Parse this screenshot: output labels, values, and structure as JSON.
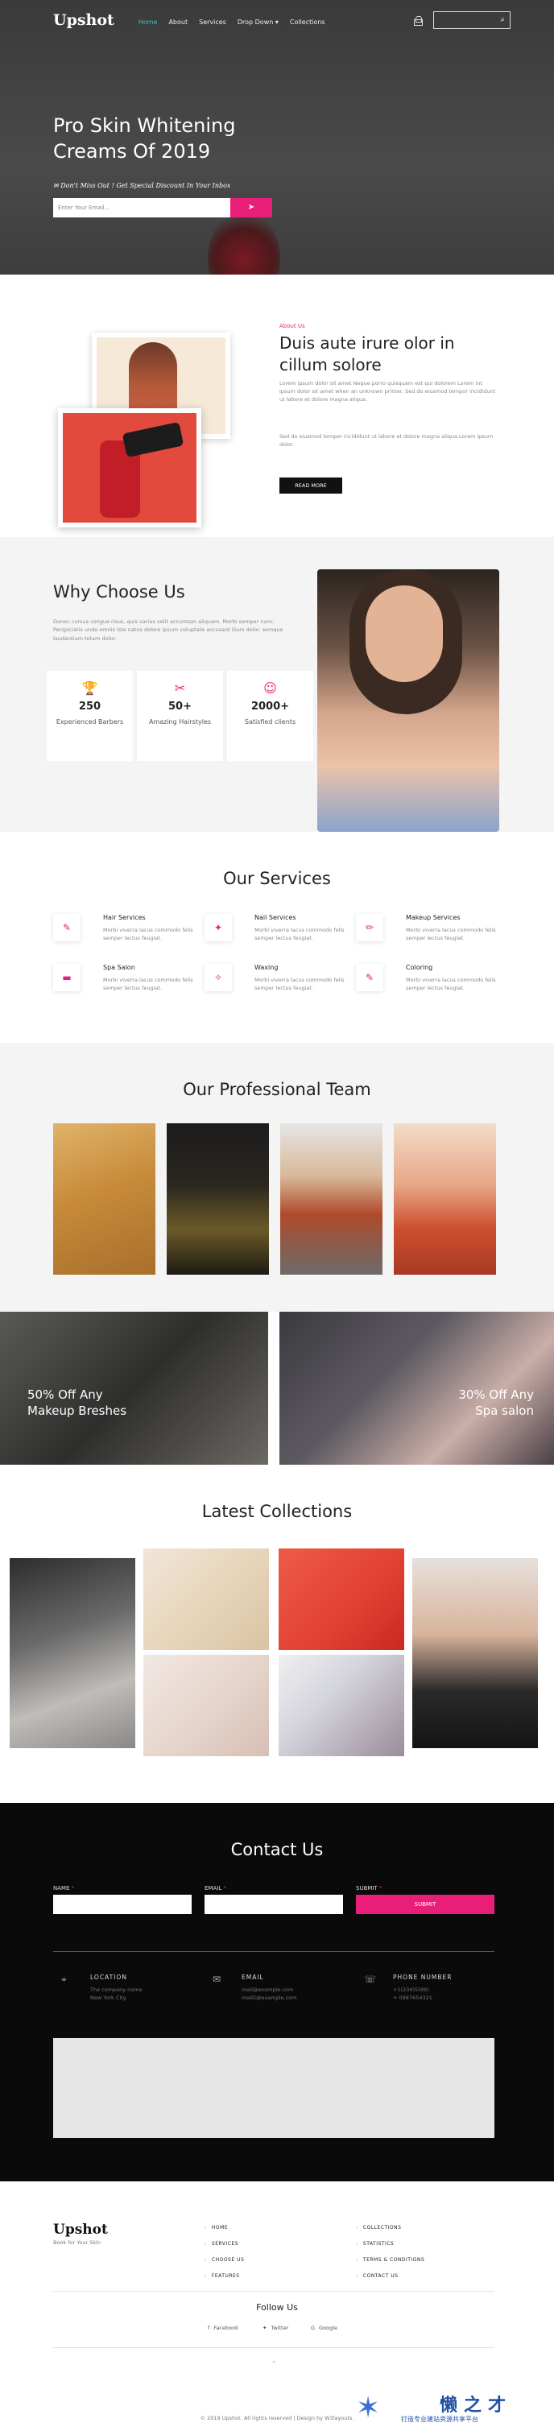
{
  "header": {
    "logo": "Upshot",
    "nav": [
      "Home",
      "About",
      "Services",
      "Drop Down ▾",
      "Collections"
    ],
    "hero_title": "Pro Skin Whitening Creams Of 2019",
    "hero_sub": "Don't Miss Out ! Get Special Discount In Your Inbox",
    "email_placeholder": "Enter Your Email...",
    "send_icon": "paper-plane-icon"
  },
  "about": {
    "tag": "About Us",
    "title": "Duis aute irure olor in cillum solore",
    "p1": "Lorem ipsum dolor sit amet Neque porro quisquam est qui dolorem Lorem int ipsum dolor sit amet when an unknown printer. Sed do eiusmod tempor incididunt ut labore et dolore magna aliqua.",
    "p2": "Sed do eiusmod tempor incididunt ut labore et dolore magna aliqua.Lorem ipsum dolor.",
    "read_more": "READ MORE"
  },
  "why": {
    "title": "Why Choose Us",
    "text": "Donec cursus congue risus, quis varius velit accumsan aliquam. Morbi semper nunc. Perspiciatis unde omnis iste natus dolore ipsum voluptate accusant ilium dolor. semque laudantium totam dolor.",
    "stats": [
      {
        "icon": "trophy-icon",
        "value": "250",
        "label": "Experienced Barbers"
      },
      {
        "icon": "scissors-icon",
        "value": "50+",
        "label": "Amazing Hairstyles"
      },
      {
        "icon": "smiley-icon",
        "value": "2000+",
        "label": "Satisfied clients"
      }
    ]
  },
  "services": {
    "title": "Our Services",
    "items": [
      {
        "name": "Hair Services",
        "desc": "Morbi viverra lacus commodo felis semper lectus feugiat."
      },
      {
        "name": "Nail Services",
        "desc": "Morbi viverra lacus commodo felis semper lectus feugiat."
      },
      {
        "name": "Makeup Services",
        "desc": "Morbi viverra lacus commodo felis semper lectus feugiat."
      },
      {
        "name": "Spa Salon",
        "desc": "Morbi viverra lacus commodo felis semper lectus feugiat."
      },
      {
        "name": "Waxing",
        "desc": "Morbi viverra lacus commodo felis semper lectus feugiat."
      },
      {
        "name": "Coloring",
        "desc": "Morbi viverra lacus commodo felis semper lectus feugiat."
      }
    ]
  },
  "team": {
    "title": "Our Professional Team"
  },
  "offers": {
    "left": "50% Off Any Makeup Breshes",
    "right": "30% Off Any Spa salon"
  },
  "latest": {
    "title": "Latest Collections"
  },
  "contact": {
    "title": "Contact Us",
    "name_label": "NAME",
    "email_label": "EMAIL",
    "submit_label": "SUBMIT",
    "submit_button": "SUBMIT",
    "required_mark": "*",
    "location_title": "LOCATION",
    "location_1": "The company name",
    "location_2": "New York City.",
    "email_title": "EMAIL",
    "email_1": "mail@example.com",
    "email_2": "mail2@example.com",
    "phone_title": "PHONE NUMBER",
    "phone_1": "+1(234)5(99)",
    "phone_2": "+ 0987654321"
  },
  "footer": {
    "logo": "Upshot",
    "tagline": "Book for Your Skin",
    "links_left": [
      "HOME",
      "SERVICES",
      "CHOOSE US",
      "FEATURES"
    ],
    "links_right": [
      "COLLECTIONS",
      "STATISTICS",
      "TERMS & CONDITIONS",
      "CONTACT US"
    ],
    "follow": "Follow Us",
    "social": [
      "Facebook",
      "Twitter",
      "Google"
    ],
    "copyright": "© 2019 Upshot. All rights reserved | Design by W3layouts."
  },
  "watermark": {
    "title": "懒之才",
    "sub": "打造专业建站资源共享平台"
  },
  "colors": {
    "accent": "#e91e78",
    "nav_active": "#2ec4c4",
    "dark": "#0a0a0a"
  }
}
